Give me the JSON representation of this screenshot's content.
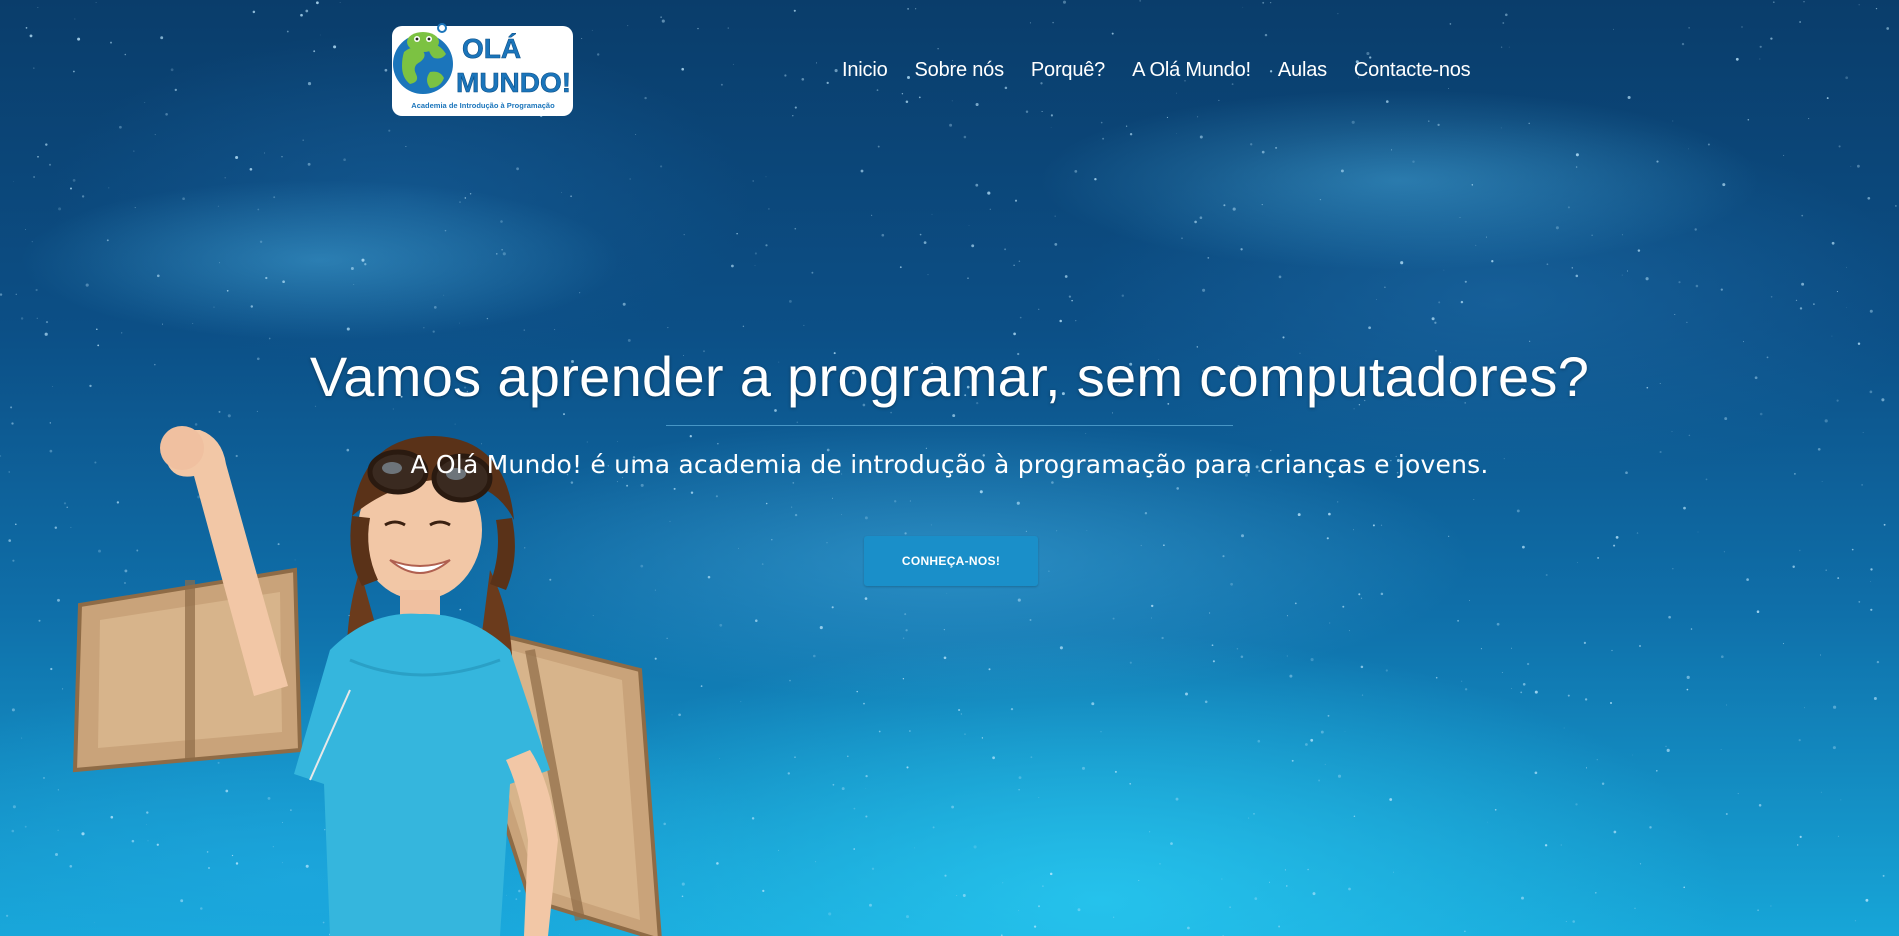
{
  "brand": {
    "logo_title_line1": "OLÁ",
    "logo_title_line2": "MUNDO!",
    "logo_tagline": "Academia de Introdução à Programação"
  },
  "nav": {
    "items": [
      {
        "label": "Inicio"
      },
      {
        "label": "Sobre nós"
      },
      {
        "label": "Porquê?"
      },
      {
        "label": "A Olá Mundo!"
      },
      {
        "label": "Aulas"
      },
      {
        "label": "Contacte-nos"
      }
    ]
  },
  "hero": {
    "headline": "Vamos aprender a programar, sem computadores?",
    "subheadline": "A Olá Mundo! é uma academia de introdução à programação para crianças e jovens.",
    "cta_label": "CONHEÇA-NOS!"
  },
  "colors": {
    "background_top": "#0a3d6b",
    "background_bottom": "#17a6d8",
    "cta": "#1a8fc9",
    "logo_green": "#7cc242",
    "logo_blue": "#1b75bb"
  },
  "icons": {
    "logo": "globe-mascot-icon"
  }
}
